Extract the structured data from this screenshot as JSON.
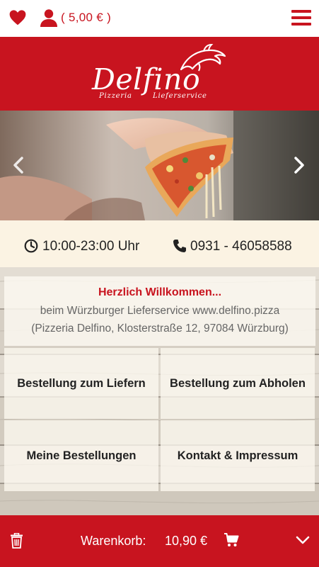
{
  "topbar": {
    "credit_text": "( 5,00 € )",
    "icons": [
      "heart-icon",
      "user-icon",
      "menu-icon"
    ]
  },
  "brand": {
    "name": "Delfino",
    "subtitle_left": "Pizzeria",
    "subtitle_right": "Lieferservice",
    "logo_icon": "dolphin-icon"
  },
  "hero": {
    "prev_icon": "chevron-left-icon",
    "next_icon": "chevron-right-icon"
  },
  "info": {
    "hours": "10:00-23:00 Uhr",
    "phone": "0931 - 46058588",
    "icons": [
      "clock-icon",
      "phone-icon"
    ]
  },
  "welcome": {
    "title": "Herzlich Willkommen...",
    "line1": "beim Würzburger Lieferservice www.delfino.pizza",
    "line2": "(Pizzeria Delfino, Klosterstraße 12, 97084 Würzburg)"
  },
  "tiles": [
    {
      "label": "Bestellung zum Liefern"
    },
    {
      "label": "Bestellung zum Abholen"
    },
    {
      "label": "Meine Bestellungen"
    },
    {
      "label": "Kontakt & Impressum"
    }
  ],
  "cart": {
    "label": "Warenkorb:",
    "total": "10,90 €",
    "icons": [
      "trash-icon",
      "cart-icon",
      "chevron-down-icon"
    ]
  },
  "colors": {
    "brand_red": "#c8141f",
    "cream": "#fbf3e3",
    "text_dark": "#222222",
    "text_grey": "#666666"
  }
}
